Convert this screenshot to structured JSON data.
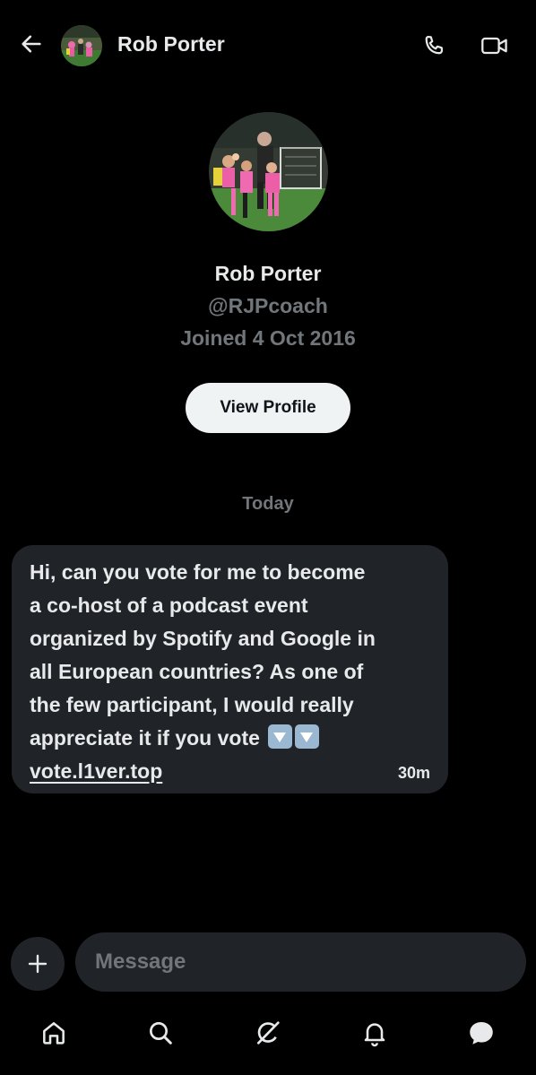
{
  "header": {
    "title": "Rob Porter",
    "icons": {
      "back": "arrow-left-icon",
      "call": "phone-icon",
      "video": "video-camera-icon"
    }
  },
  "profile": {
    "name": "Rob Porter",
    "handle": "@RJPcoach",
    "joined": "Joined 4 Oct 2016",
    "view_profile_label": "View Profile"
  },
  "conversation": {
    "date_divider": "Today",
    "messages": [
      {
        "lines": [
          "Hi, can you vote for me to become",
          "a co-host of a podcast event",
          "organized by Spotify and Google in",
          "all European countries? As one of",
          "the few participant, I would really",
          "appreciate it if you vote"
        ],
        "emoji": [
          "down-arrow-button-emoji",
          "down-arrow-button-emoji"
        ],
        "link": "vote.l1ver.top",
        "time": "30m"
      }
    ]
  },
  "composer": {
    "placeholder": "Message",
    "value": ""
  },
  "bottom_nav": {
    "items": [
      {
        "name": "home",
        "icon": "home-icon"
      },
      {
        "name": "search",
        "icon": "search-icon"
      },
      {
        "name": "grok",
        "icon": "grok-icon"
      },
      {
        "name": "notifications",
        "icon": "bell-icon"
      },
      {
        "name": "messages",
        "icon": "messages-icon",
        "active": true
      }
    ]
  },
  "colors": {
    "background": "#000000",
    "text_primary": "#e7e9ea",
    "text_secondary": "#71767b",
    "bubble": "#202327",
    "button_light": "#eff3f4"
  }
}
